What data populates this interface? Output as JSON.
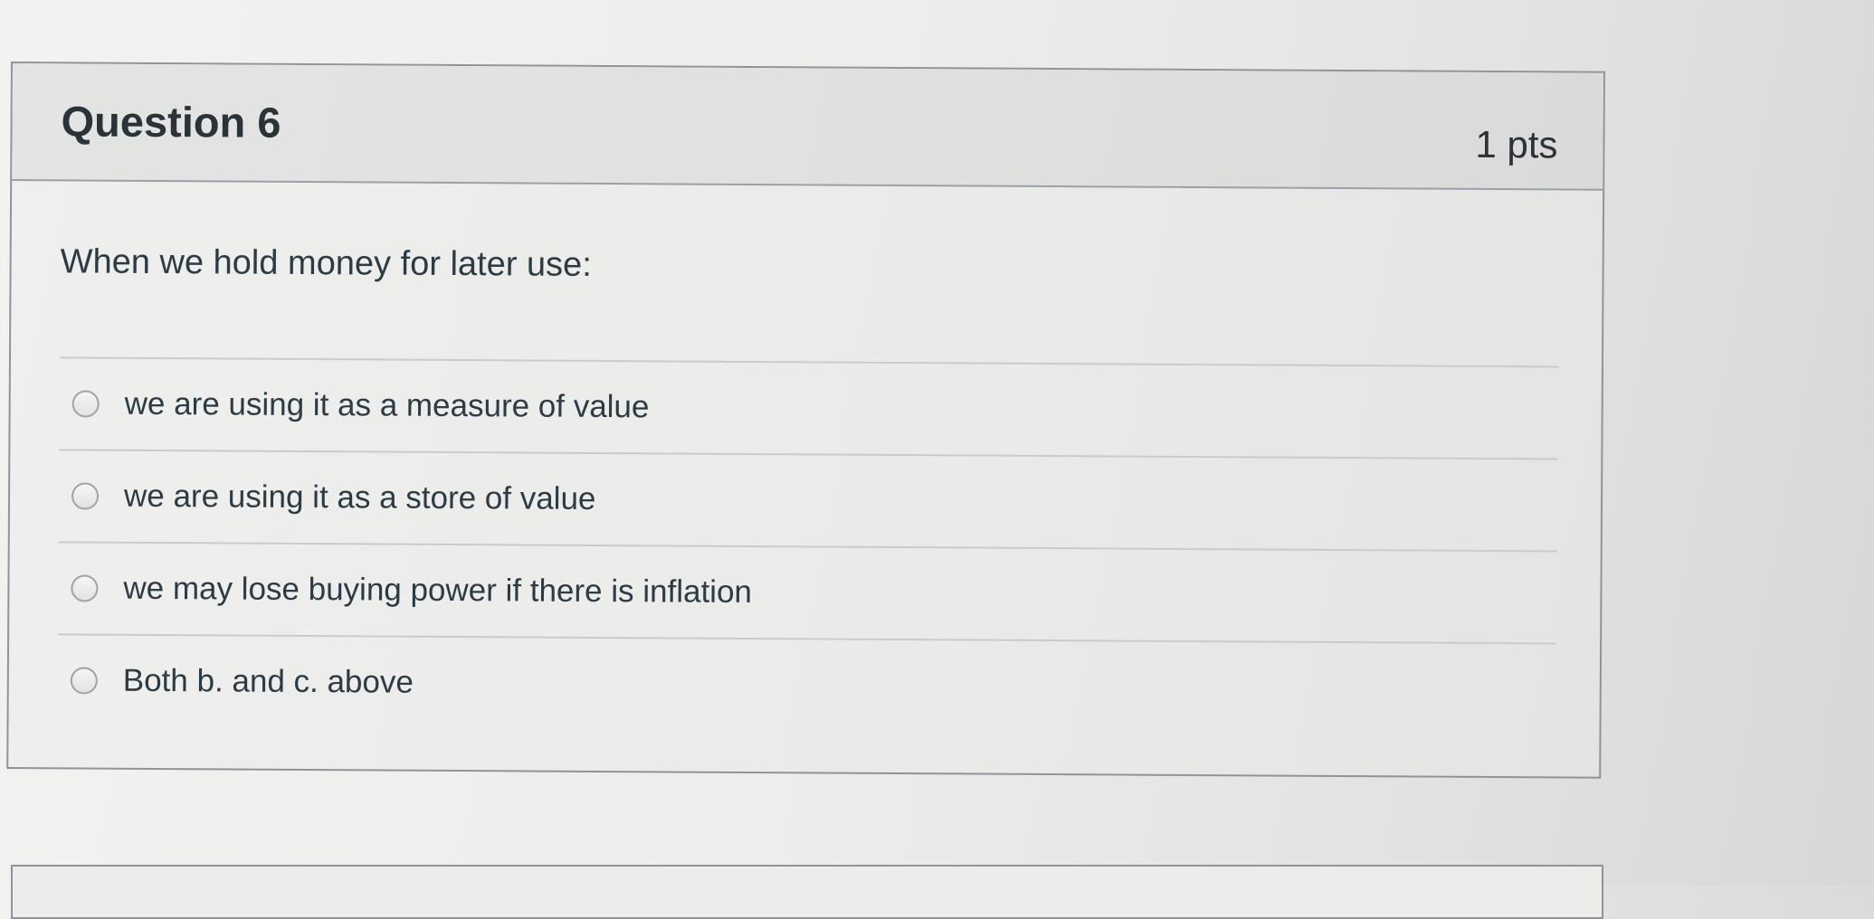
{
  "question": {
    "title": "Question 6",
    "points": "1 pts",
    "text": "When we hold money for later use:",
    "answers": [
      {
        "label": "we are using it as a measure of value"
      },
      {
        "label": "we are using it as a store of value"
      },
      {
        "label": "we may lose buying power if there is inflation"
      },
      {
        "label": "Both b. and c. above"
      }
    ]
  },
  "colors": {
    "text": "#2d3b45",
    "border": "#8f9499",
    "header_bg": "#e0e1e0"
  }
}
